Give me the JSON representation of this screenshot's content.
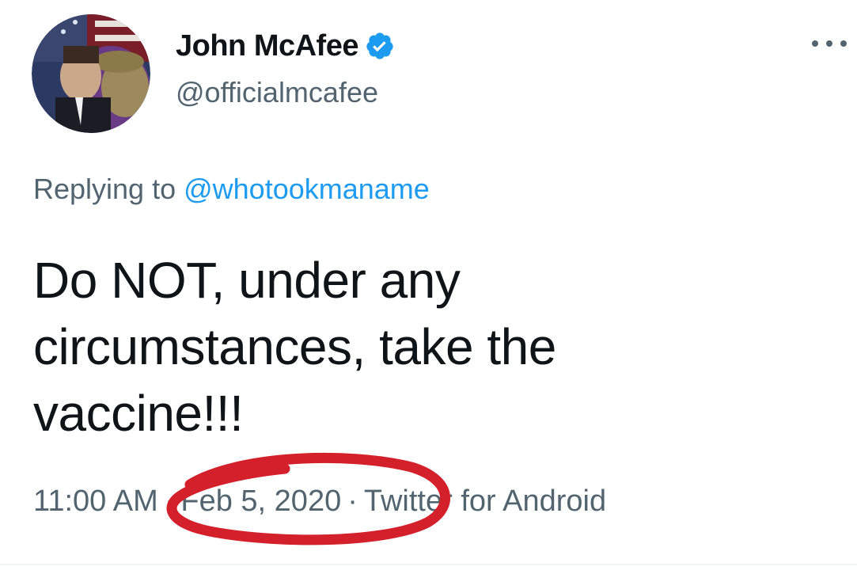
{
  "author": {
    "display_name": "John McAfee",
    "handle": "@officialmcafee",
    "verified_icon": "verified-badge-icon"
  },
  "menu": {
    "icon": "more-options-icon"
  },
  "reply": {
    "prefix": "Replying to ",
    "mention": "@whotookmaname"
  },
  "tweet": {
    "text_lines": [
      "Do NOT, under any",
      "circumstances, take the",
      "vaccine!!!"
    ]
  },
  "meta": {
    "time": "11:00 AM",
    "date": "Feb 5, 2020",
    "source": "Twitter for Android",
    "separator": "·"
  },
  "colors": {
    "name": "#0f1419",
    "secondary": "#536471",
    "link": "#1d9bf0",
    "verified": "#1d9bf0",
    "annotation": "#d4202a"
  }
}
